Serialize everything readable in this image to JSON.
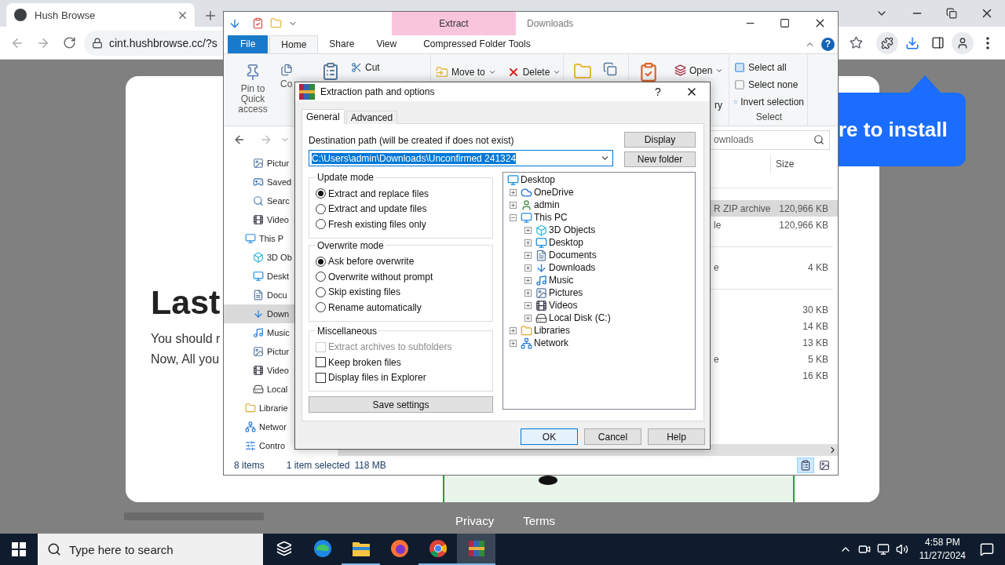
{
  "browser": {
    "tab_title": "Hush Browse",
    "url": "cint.hushbrowse.cc/?s",
    "page": {
      "heading": "Last",
      "lines": [
        "You should r",
        "Now, All you"
      ],
      "bubble": "re to install",
      "footer": [
        "Privacy",
        "Terms"
      ]
    }
  },
  "explorer": {
    "title": "Downloads",
    "context_label": "Extract",
    "help": "?",
    "tabs": [
      {
        "label": "File",
        "kind": "menu",
        "selected": false
      },
      {
        "label": "Home",
        "kind": "tab",
        "selected": true
      },
      {
        "label": "Share",
        "kind": "tab",
        "selected": false
      },
      {
        "label": "View",
        "kind": "tab",
        "selected": false
      },
      {
        "label": "Compressed Folder Tools",
        "kind": "tab",
        "selected": false
      }
    ],
    "ribbon": {
      "pin": "Pin to Quick access",
      "copy": "Co",
      "cut": "Cut",
      "move_to": "Move to",
      "delete": "Delete",
      "open": "Open",
      "history": "ry",
      "select_all": "Select all",
      "select_none": "Select none",
      "invert_selection": "Invert selection",
      "select_group": "Select"
    },
    "search": {
      "placeholder": "ownloads"
    },
    "nav": {
      "quick_access": [
        {
          "label": "Pictur",
          "kind": "pictures",
          "selected": false
        },
        {
          "label": "Saved",
          "kind": "saved",
          "selected": false
        },
        {
          "label": "Searc",
          "kind": "search",
          "selected": false
        },
        {
          "label": "Video",
          "kind": "videos",
          "selected": false
        }
      ],
      "items": [
        {
          "label": "This P",
          "kind": "pc",
          "selected": false,
          "children": [
            {
              "label": "3D Ob",
              "kind": "cube",
              "selected": false
            },
            {
              "label": "Deskt",
              "kind": "desktop",
              "selected": false
            },
            {
              "label": "Docu",
              "kind": "documents",
              "selected": false
            },
            {
              "label": "Down",
              "kind": "downloads",
              "selected": true
            },
            {
              "label": "Music",
              "kind": "music",
              "selected": false
            },
            {
              "label": "Pictur",
              "kind": "pictures",
              "selected": false
            },
            {
              "label": "Video",
              "kind": "videos",
              "selected": false
            },
            {
              "label": "Local",
              "kind": "disk",
              "selected": false
            }
          ]
        },
        {
          "label": "Librarie",
          "kind": "libraries",
          "selected": false
        },
        {
          "label": "Networ",
          "kind": "network",
          "selected": false
        },
        {
          "label": "Contro",
          "kind": "control",
          "selected": false
        }
      ]
    },
    "columns": [
      "Size"
    ],
    "groups": [
      {
        "rows": [
          {
            "type": "R ZIP archive",
            "size": "120,966 KB",
            "selected": true
          },
          {
            "type": "le",
            "size": "120,966 KB",
            "selected": false
          }
        ]
      },
      {
        "rows": [
          {
            "type": "e",
            "size": "4 KB",
            "selected": false
          }
        ]
      },
      {
        "rows": [
          {
            "size": "30 KB",
            "selected": false
          },
          {
            "size": "14 KB",
            "selected": false
          },
          {
            "size": "13 KB",
            "selected": false
          },
          {
            "type": "e",
            "size": "5 KB",
            "selected": false
          },
          {
            "size": "16 KB",
            "selected": false
          }
        ]
      }
    ],
    "status": {
      "items": "8 items",
      "selection": "1 item selected",
      "size": "118 MB"
    }
  },
  "dialog": {
    "title": "Extraction path and options",
    "help": "?",
    "tabs": [
      {
        "label": "General",
        "selected": true
      },
      {
        "label": "Advanced",
        "selected": false
      }
    ],
    "destination_label": "Destination path (will be created if does not exist)",
    "destination_value": "C:\\Users\\admin\\Downloads\\Unconfirmed 241324",
    "side_buttons": [
      "Display",
      "New folder"
    ],
    "update_mode": {
      "title": "Update mode",
      "options": [
        {
          "label": "Extract and replace files",
          "selected": true
        },
        {
          "label": "Extract and update files",
          "selected": false
        },
        {
          "label": "Fresh existing files only",
          "selected": false
        }
      ]
    },
    "overwrite_mode": {
      "title": "Overwrite mode",
      "options": [
        {
          "label": "Ask before overwrite",
          "selected": true
        },
        {
          "label": "Overwrite without prompt",
          "selected": false
        },
        {
          "label": "Skip existing files",
          "selected": false
        },
        {
          "label": "Rename automatically",
          "selected": false
        }
      ]
    },
    "misc": {
      "title": "Miscellaneous",
      "options": [
        {
          "label": "Extract archives to subfolders",
          "checked": false,
          "disabled": true
        },
        {
          "label": "Keep broken files",
          "checked": false,
          "disabled": false
        },
        {
          "label": "Display files in Explorer",
          "checked": false,
          "disabled": false
        }
      ]
    },
    "save": "Save settings",
    "tree": {
      "label": "Desktop",
      "kind": "desktop",
      "children": [
        {
          "label": "OneDrive",
          "kind": "cloud",
          "expanded": false
        },
        {
          "label": "admin",
          "kind": "user",
          "expanded": false
        },
        {
          "label": "This PC",
          "kind": "pc",
          "expanded": true,
          "children": [
            {
              "label": "3D Objects",
              "kind": "cube",
              "expanded": false
            },
            {
              "label": "Desktop",
              "kind": "desktop",
              "expanded": false
            },
            {
              "label": "Documents",
              "kind": "documents",
              "expanded": false
            },
            {
              "label": "Downloads",
              "kind": "downloads",
              "expanded": false
            },
            {
              "label": "Music",
              "kind": "music",
              "expanded": false
            },
            {
              "label": "Pictures",
              "kind": "pictures",
              "expanded": false
            },
            {
              "label": "Videos",
              "kind": "videos",
              "expanded": false
            },
            {
              "label": "Local Disk (C:)",
              "kind": "disk",
              "expanded": false
            }
          ]
        },
        {
          "label": "Libraries",
          "kind": "libraries",
          "expanded": false
        },
        {
          "label": "Network",
          "kind": "network",
          "expanded": false
        }
      ]
    },
    "buttons": [
      {
        "label": "OK",
        "default": true
      },
      {
        "label": "Cancel",
        "default": false
      },
      {
        "label": "Help",
        "default": false
      }
    ]
  },
  "taskbar": {
    "search_placeholder": "Type here to search",
    "apps": [
      {
        "kind": "edge",
        "running": false,
        "active": false
      },
      {
        "kind": "files",
        "running": true,
        "active": false
      },
      {
        "kind": "firefox",
        "running": false,
        "active": false
      },
      {
        "kind": "chrome",
        "running": true,
        "active": false
      },
      {
        "kind": "winrar",
        "running": true,
        "active": true
      }
    ],
    "time": "4:58 PM",
    "date": "11/27/2024"
  }
}
